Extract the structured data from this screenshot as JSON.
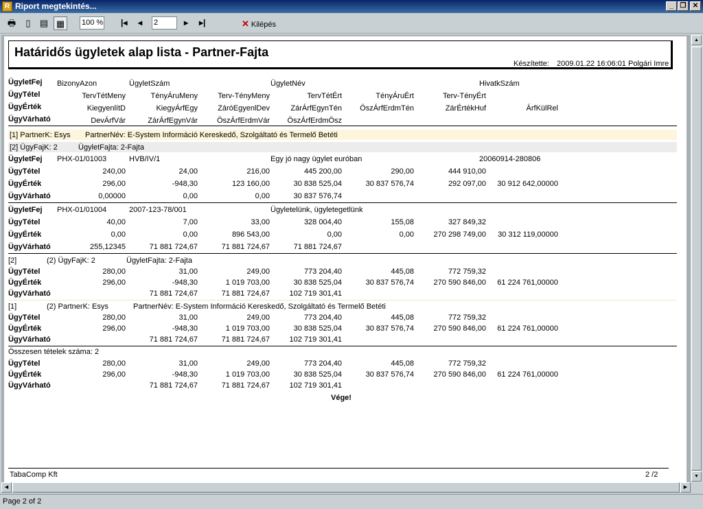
{
  "window": {
    "title": "Riport megtekintés...",
    "icon_letter": "R"
  },
  "toolbar": {
    "zoom": "100 %",
    "page": "2",
    "exit_label": "Kilépés"
  },
  "status": {
    "text": "Page 2 of 2"
  },
  "report": {
    "title": "Határidős ügyletek alap lista - Partner-Fajta",
    "made_by_label": "Készítette:",
    "made_date": "2009.01.22 16:06:01",
    "made_by": "Polgári Imre",
    "col_labels": [
      "ÜgyletFej",
      "ÜgyTétel",
      "ÜgyÉrték",
      "ÜgyVárható"
    ],
    "col_headers": {
      "fej": [
        "BizonyAzon",
        "ÜgyletSzám",
        "ÜgyletNév",
        "HivatkSzám"
      ],
      "tetel": [
        "TervTétMeny",
        "TényÁruMeny",
        "Terv-TényMeny",
        "TervTétÉrt",
        "TényÁruÉrt",
        "Terv-TényÉrt"
      ],
      "ertek": [
        "KiegyenlítD",
        "KiegyÁrfEgy",
        "ZáróEgyenlDev",
        "ZárÁrfEgynTén",
        "ÖszÁrfErdmTén",
        "ZárÉrtékHuf",
        "ÁrfKülRel"
      ],
      "varhato": [
        "DevÁrfVár",
        "ZárÁrfEgynVár",
        "ÖszÁrfErdmVár",
        "ÖszÁrfErdmÖsz"
      ]
    },
    "group_partner": "[1] PartnerK: Esys",
    "group_partner_name": "PartnerNév: E-System Információ Kereskedő, Szolgáltató és Termelő Betéti",
    "group_fajta": "[2] ÜgyFajK:  2",
    "group_fajta_name": "ÜgyletFajta:  2-Fajta",
    "deal1": {
      "bizony": "PHX-01/01003",
      "szam": "HVB/IV/1",
      "nev": "Egy jó nagy ügylet euróban",
      "hivatk": "20060914-280806",
      "tetel": [
        "240,00",
        "24,00",
        "216,00",
        "445 200,00",
        "290,00",
        "444 910,00"
      ],
      "ertek": [
        "296,00",
        "-948,30",
        "123 160,00",
        "30 838 525,04",
        "30 837 576,74",
        "292 097,00",
        "30 912 642,00000"
      ],
      "varhato": [
        "0,00000",
        "0,00",
        "0,00",
        "30 837 576,74"
      ]
    },
    "deal2": {
      "bizony": "PHX-01/01004",
      "szam": "2007-123-78/001",
      "nev": "Ügyletelünk, ügyletegetlünk",
      "tetel": [
        "40,00",
        "7,00",
        "33,00",
        "328 004,40",
        "155,08",
        "327 849,32"
      ],
      "ertek": [
        "0,00",
        "0,00",
        "896 543,00",
        "0,00",
        "0,00",
        "270 298 749,00",
        "30 312 119,00000"
      ],
      "varhato": [
        "255,12345",
        "71 881 724,67",
        "71 881 724,67",
        "71 881 724,67"
      ]
    },
    "sum_fajta": {
      "idx": "[2]",
      "label": "(2) ÜgyFajK:  2",
      "name": "ÜgyletFajta:  2-Fajta",
      "tetel": [
        "280,00",
        "31,00",
        "249,00",
        "773 204,40",
        "445,08",
        "772 759,32"
      ],
      "ertek": [
        "296,00",
        "-948,30",
        "1 019 703,00",
        "30 838 525,04",
        "30 837 576,74",
        "270 590 846,00",
        "61 224 761,00000"
      ],
      "varhato": [
        "71 881 724,67",
        "71 881 724,67",
        "102 719 301,41"
      ]
    },
    "sum_partner": {
      "idx": "[1]",
      "label": "(2) PartnerK:  Esys",
      "name": "PartnerNév: E-System Információ Kereskedő, Szolgáltató és Termelő Betéti",
      "tetel": [
        "280,00",
        "31,00",
        "249,00",
        "773 204,40",
        "445,08",
        "772 759,32"
      ],
      "ertek": [
        "296,00",
        "-948,30",
        "1 019 703,00",
        "30 838 525,04",
        "30 837 576,74",
        "270 590 846,00",
        "61 224 761,00000"
      ],
      "varhato": [
        "71 881 724,67",
        "71 881 724,67",
        "102 719 301,41"
      ]
    },
    "total": {
      "label": "Összesen tételek száma: 2",
      "tetel": [
        "280,00",
        "31,00",
        "249,00",
        "773 204,40",
        "445,08",
        "772 759,32"
      ],
      "ertek": [
        "296,00",
        "-948,30",
        "1 019 703,00",
        "30 838 525,04",
        "30 837 576,74",
        "270 590 846,00",
        "61 224 761,00000"
      ],
      "varhato": [
        "71 881 724,67",
        "71 881 724,67",
        "102 719 301,41"
      ]
    },
    "end": "Vége!",
    "footer_company": "TabaComp Kft",
    "footer_page": "2  /2"
  }
}
